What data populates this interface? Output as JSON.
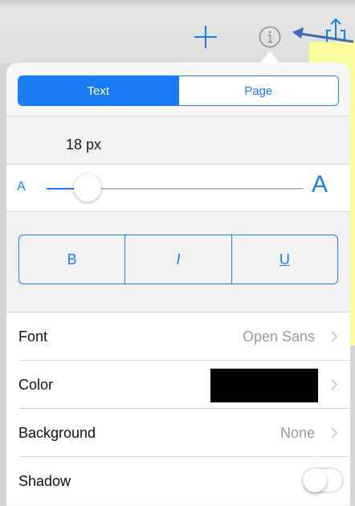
{
  "toolbar": {
    "add_icon": "plus-icon",
    "info_icon": "info-icon",
    "share_icon": "share-icon",
    "accent": "#1a7cf5"
  },
  "tabs": [
    {
      "label": "Text",
      "active": true
    },
    {
      "label": "Page",
      "active": false
    }
  ],
  "font_size": {
    "label": "18 px",
    "small_glyph": "A",
    "large_glyph": "A",
    "slider_fraction": 0.16
  },
  "styles": {
    "bold": "B",
    "italic": "I",
    "underline": "U"
  },
  "rows": {
    "font": {
      "label": "Font",
      "value": "Open Sans"
    },
    "color": {
      "label": "Color",
      "value_color": "#000000"
    },
    "background": {
      "label": "Background",
      "value": "None"
    },
    "shadow": {
      "label": "Shadow",
      "on": false
    }
  },
  "colors": {
    "accent": "#1a7cf5",
    "note": "#fbfb9f"
  }
}
